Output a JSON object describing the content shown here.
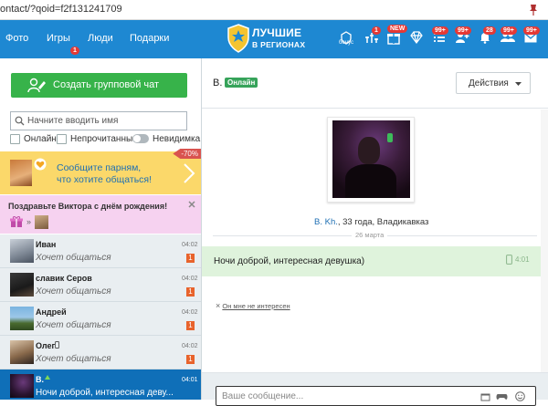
{
  "browser": {
    "url": "ontact/?qoid=f2f131241709"
  },
  "nav": {
    "links": [
      {
        "label": "Фото",
        "badge": ""
      },
      {
        "label": "Игры",
        "badge": "1"
      },
      {
        "label": "Люди",
        "badge": ""
      },
      {
        "label": "Подарки",
        "badge": ""
      }
    ],
    "logo_line1": "ЛУЧШИЕ",
    "logo_line2": "В РЕГИОНАХ",
    "bonus_label": "бонус",
    "icons": [
      {
        "name": "bonus-icon",
        "badge": ""
      },
      {
        "name": "rating-icon",
        "badge": "1"
      },
      {
        "name": "gift-icon",
        "badge": "NEW"
      },
      {
        "name": "diamond-icon",
        "badge": ""
      },
      {
        "name": "list-icon",
        "badge": "99+"
      },
      {
        "name": "friend-add-icon",
        "badge": "99+"
      },
      {
        "name": "notification-bell-icon",
        "badge": "28"
      },
      {
        "name": "guests-icon",
        "badge": "99+"
      },
      {
        "name": "messages-icon",
        "badge": "99+"
      }
    ]
  },
  "sidebar": {
    "group_chat_label": "Создать групповой чат",
    "search_placeholder": "Начните вводить имя",
    "filters": {
      "online": "Онлайн",
      "unread": "Непрочитанные",
      "invisible": "Невидимка"
    },
    "promo": {
      "line1": "Сообщите парням,",
      "line2": "что хотите общаться!",
      "discount": "-70%"
    },
    "birthday": {
      "text": "Поздравьте Виктора с днём рождения!"
    },
    "conversations": [
      {
        "name": "Иван",
        "message": "Хочет общаться",
        "time": "04:02",
        "count": "1"
      },
      {
        "name": "славик Серов",
        "message": "Хочет общаться",
        "time": "04:02",
        "count": "1"
      },
      {
        "name": "Андрей",
        "message": "Хочет общаться",
        "time": "04:02",
        "count": "1"
      },
      {
        "name": "Олег",
        "message": "Хочет общаться",
        "time": "04:02",
        "count": "1"
      },
      {
        "name": "В.",
        "message": "Ночи доброй, интересная деву...",
        "time": "04:01",
        "count": ""
      }
    ]
  },
  "chat": {
    "name": "В.",
    "status": "Онлайн",
    "actions_label": "Действия",
    "profile_name": "В. Kh.",
    "profile_details": ", 33 года, Владикавказ",
    "date": "26 марта",
    "message_text": "Ночи доброй, интересная девушка)",
    "message_time": "4:01",
    "not_interested": "Он мне не интересен",
    "compose_placeholder": "Ваше сообщение..."
  },
  "colors": {
    "nav_bg": "#1e88d2",
    "green": "#37b34a",
    "badge_red": "#e53935",
    "active_row": "#0f6fb8"
  }
}
